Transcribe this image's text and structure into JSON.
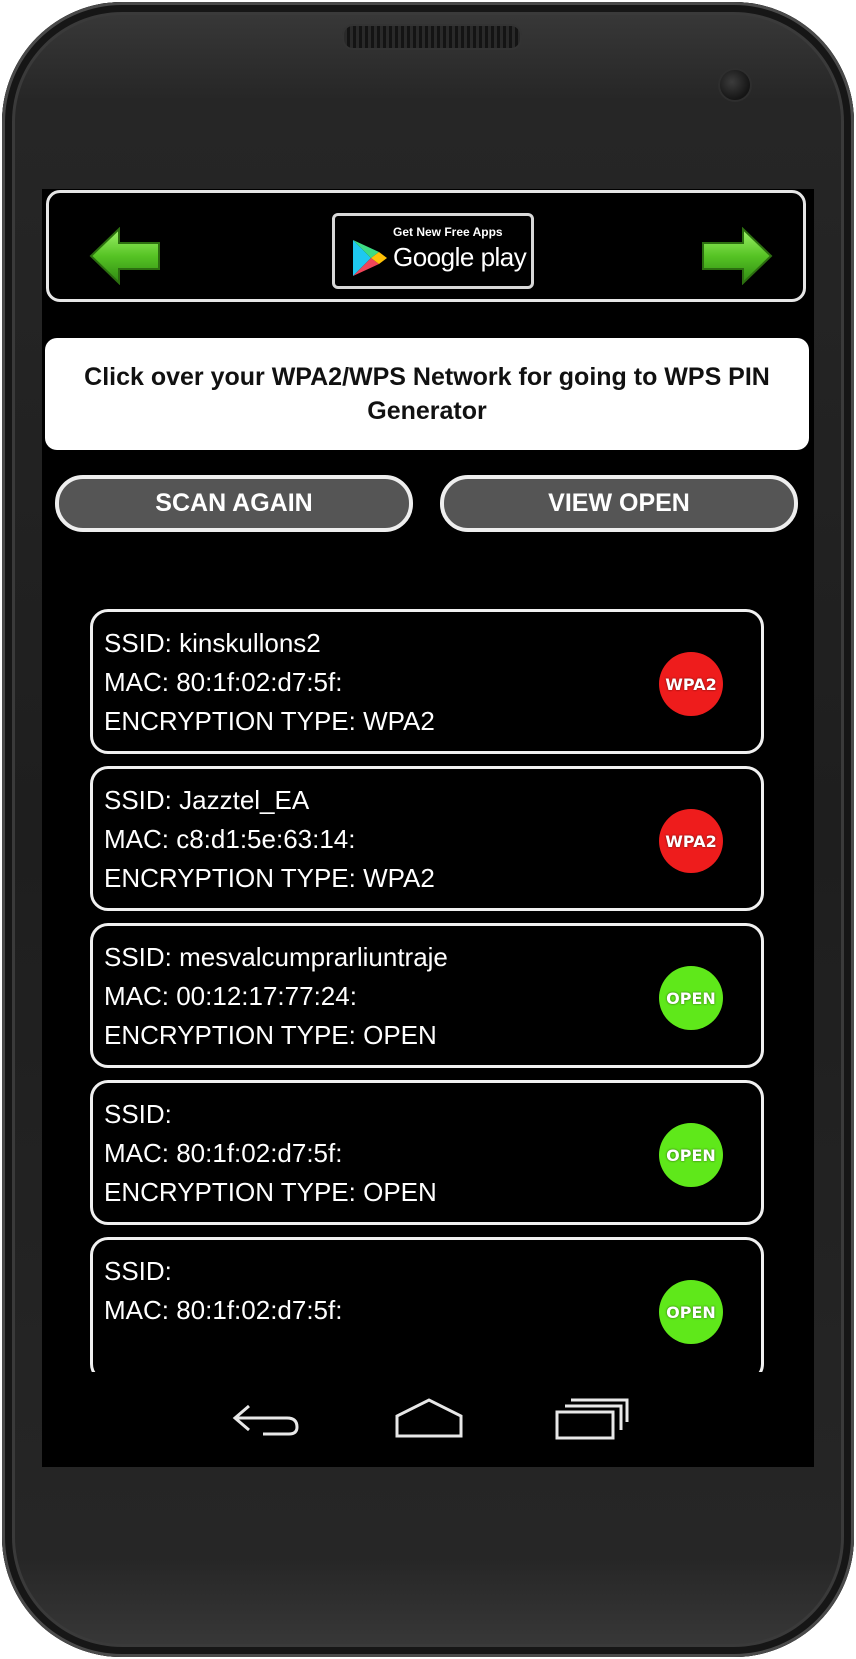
{
  "ad_banner": {
    "left_arrow_icon": "green-left-arrow",
    "right_arrow_icon": "green-right-arrow",
    "store_badge_top": "Get New Free Apps",
    "store_badge_main": "Google play",
    "store_icon": "google-play-logo"
  },
  "instruction_text": "Click over your WPA2/WPS Network for going to WPS PIN Generator",
  "buttons": {
    "scan_again": "SCAN AGAIN",
    "view_open": "VIEW OPEN"
  },
  "networks": [
    {
      "ssid": "SSID: kinskullons2",
      "mac": "MAC: 80:1f:02:d7:5f:",
      "encryption": "ENCRYPTION TYPE: WPA2",
      "badge": "WPA2",
      "badge_color": "#ee1c1c"
    },
    {
      "ssid": "SSID: Jazztel_EA",
      "mac": "MAC: c8:d1:5e:63:14:",
      "encryption": "ENCRYPTION TYPE: WPA2",
      "badge": "WPA2",
      "badge_color": "#ee1c1c"
    },
    {
      "ssid": "SSID: mesvalcumprarliuntraje",
      "mac": "MAC: 00:12:17:77:24:",
      "encryption": "ENCRYPTION TYPE: OPEN",
      "badge": "OPEN",
      "badge_color": "#5fe81a"
    },
    {
      "ssid": "SSID:",
      "mac": "MAC: 80:1f:02:d7:5f:",
      "encryption": "ENCRYPTION TYPE: OPEN",
      "badge": "OPEN",
      "badge_color": "#5fe81a"
    },
    {
      "ssid": "SSID:",
      "mac": "MAC: 80:1f:02:d7:5f:",
      "encryption": "",
      "badge": "OPEN",
      "badge_color": "#5fe81a"
    }
  ],
  "nav_bar": {
    "back_icon": "back-icon",
    "home_icon": "home-icon",
    "recent_icon": "recent-apps-icon"
  }
}
